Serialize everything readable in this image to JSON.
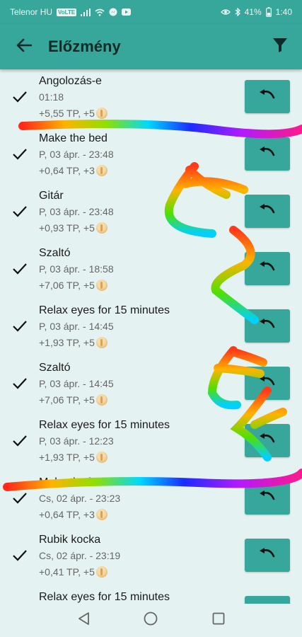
{
  "status_bar": {
    "carrier": "Telenor HU",
    "volte": "VoLTE",
    "battery": "41%",
    "clock": "1:40"
  },
  "app_bar": {
    "title": "Előzmény",
    "back_icon": "arrow-back-icon",
    "filter_icon": "filter-icon"
  },
  "colors": {
    "primary": "#36a79a",
    "background": "#e4f2f1"
  },
  "history": [
    {
      "name": "Angolozás-e",
      "time": "01:18",
      "reward": "+5,55 TP, +5"
    },
    {
      "name": "Make the bed",
      "time": "P, 03 ápr. - 23:48",
      "reward": "+0,64 TP, +3"
    },
    {
      "name": "Gitár",
      "time": "P, 03 ápr. - 23:48",
      "reward": "+0,93 TP, +5"
    },
    {
      "name": "Szaltó",
      "time": "P, 03 ápr. - 18:58",
      "reward": "+7,06 TP, +5"
    },
    {
      "name": "Relax eyes for 15 minutes",
      "time": "P, 03 ápr. - 14:45",
      "reward": "+1,93 TP, +5"
    },
    {
      "name": "Szaltó",
      "time": "P, 03 ápr. - 14:45",
      "reward": "+7,06 TP, +5"
    },
    {
      "name": "Relax eyes for 15 minutes",
      "time": "P, 03 ápr. - 12:23",
      "reward": "+1,93 TP, +5"
    },
    {
      "name": "Make the bed",
      "time": "Cs, 02 ápr. - 23:23",
      "reward": "+0,64 TP, +3"
    },
    {
      "name": "Rubik kocka",
      "time": "Cs, 02 ápr. - 23:19",
      "reward": "+0,41 TP, +5"
    },
    {
      "name": "Relax eyes for 15 minutes",
      "time": "",
      "reward": ""
    }
  ]
}
